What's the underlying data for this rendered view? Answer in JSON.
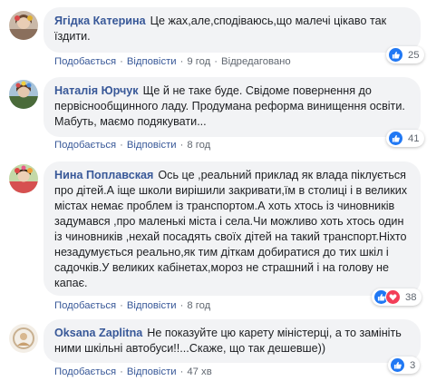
{
  "comments": [
    {
      "author": "Ягідка Катерина",
      "text": "Це жах,але,сподіваюсь,що малечі цікаво так їздити.",
      "like_label": "Подобається",
      "reply_label": "Відповісти",
      "time": "9 год",
      "edited_label": "Відредаговано",
      "reaction_count": "25"
    },
    {
      "author": "Наталія Юрчук",
      "text": "Ще й не таке буде. Свідоме повернення до первіснообщинного ладу. Продумана реформа винищення освіти. Мабуть, маємо подякувати...",
      "like_label": "Подобається",
      "reply_label": "Відповісти",
      "time": "8 год",
      "reaction_count": "41"
    },
    {
      "author": "Нина Поплавская",
      "text": "Ось це ,реальний приклад як влада піклується про дітей.А іще школи вирішили закривати,їм в столиці і в великих містах немає проблем із транспортом.А хоть хтось із чиновників задумався ,про маленькі міста і села.Чи можливо хоть хтось один із чиновників ,нехай посадять своїх дітей на такий транспорт.Ніхто незадумується реально,як тим діткам добиратися до тих шкіл і садочків.У великих кабінетах,мороз не страшний і на голову не капає.",
      "like_label": "Подобається",
      "reply_label": "Відповісти",
      "time": "8 год",
      "reaction_count": "38"
    },
    {
      "author": "Oksana Zaplitna",
      "text": "Не показуйте цю карету міністерці, а то замініть ними шкільні автобуси!!...Скаже, що так дешевше))",
      "like_label": "Подобається",
      "reply_label": "Відповісти",
      "time": "47 хв",
      "reaction_count": "3"
    }
  ],
  "colors": {
    "like_blue": "#2078f4",
    "love_red": "#f33e58",
    "author_link": "#385898",
    "bubble_bg": "#f2f3f5"
  },
  "icons": {
    "like": "thumbs-up-icon",
    "love": "heart-icon"
  }
}
